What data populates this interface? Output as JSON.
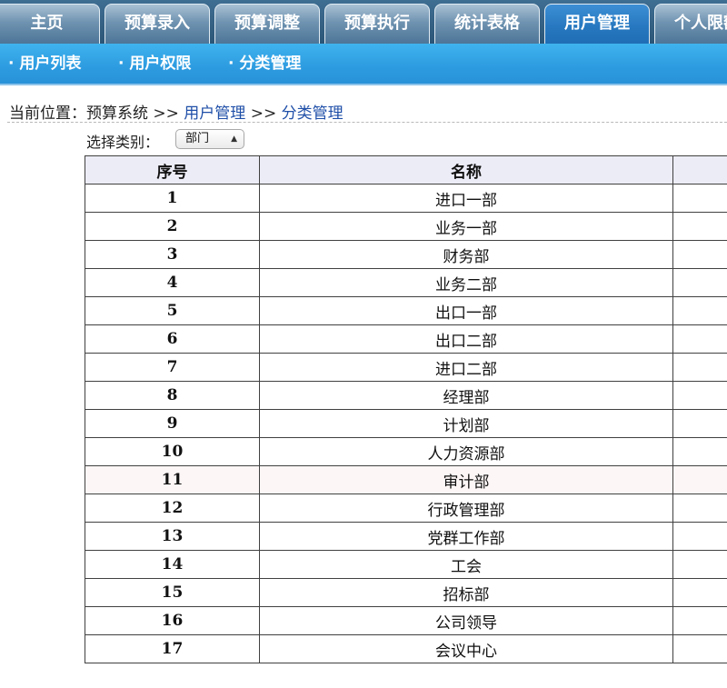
{
  "top_tabs": [
    {
      "label": "主页",
      "active": false
    },
    {
      "label": "预算录入",
      "active": false
    },
    {
      "label": "预算调整",
      "active": false
    },
    {
      "label": "预算执行",
      "active": false
    },
    {
      "label": "统计表格",
      "active": false
    },
    {
      "label": "用户管理",
      "active": true
    },
    {
      "label": "个人限额",
      "active": false
    }
  ],
  "sub_tabs": [
    "· 用户列表",
    "· 用户权限",
    "· 分类管理"
  ],
  "breadcrumb": {
    "prefix": "当前位置：预算系统 >> ",
    "level1": "用户管理",
    "sep": " >> ",
    "level2": "分类管理"
  },
  "filter": {
    "label": "选择类别：",
    "selected": "部门"
  },
  "table": {
    "headers": [
      "序号",
      "名称",
      ""
    ],
    "rows": [
      {
        "no": "1",
        "name": "进口一部"
      },
      {
        "no": "2",
        "name": "业务一部"
      },
      {
        "no": "3",
        "name": "财务部"
      },
      {
        "no": "4",
        "name": "业务二部"
      },
      {
        "no": "5",
        "name": "出口一部"
      },
      {
        "no": "6",
        "name": "出口二部"
      },
      {
        "no": "7",
        "name": "进口二部"
      },
      {
        "no": "8",
        "name": "经理部"
      },
      {
        "no": "9",
        "name": "计划部"
      },
      {
        "no": "10",
        "name": "人力资源部"
      },
      {
        "no": "11",
        "name": "审计部"
      },
      {
        "no": "12",
        "name": "行政管理部"
      },
      {
        "no": "13",
        "name": "党群工作部"
      },
      {
        "no": "14",
        "name": "工会"
      },
      {
        "no": "15",
        "name": "招标部"
      },
      {
        "no": "16",
        "name": "公司领导"
      },
      {
        "no": "17",
        "name": "会议中心"
      }
    ]
  },
  "colors": {
    "nav_dark": "#2c5677",
    "tab_active": "#2778c0",
    "subnav": "#2d9be0",
    "link": "#1f4fa8",
    "header_bg": "#ececf7"
  }
}
